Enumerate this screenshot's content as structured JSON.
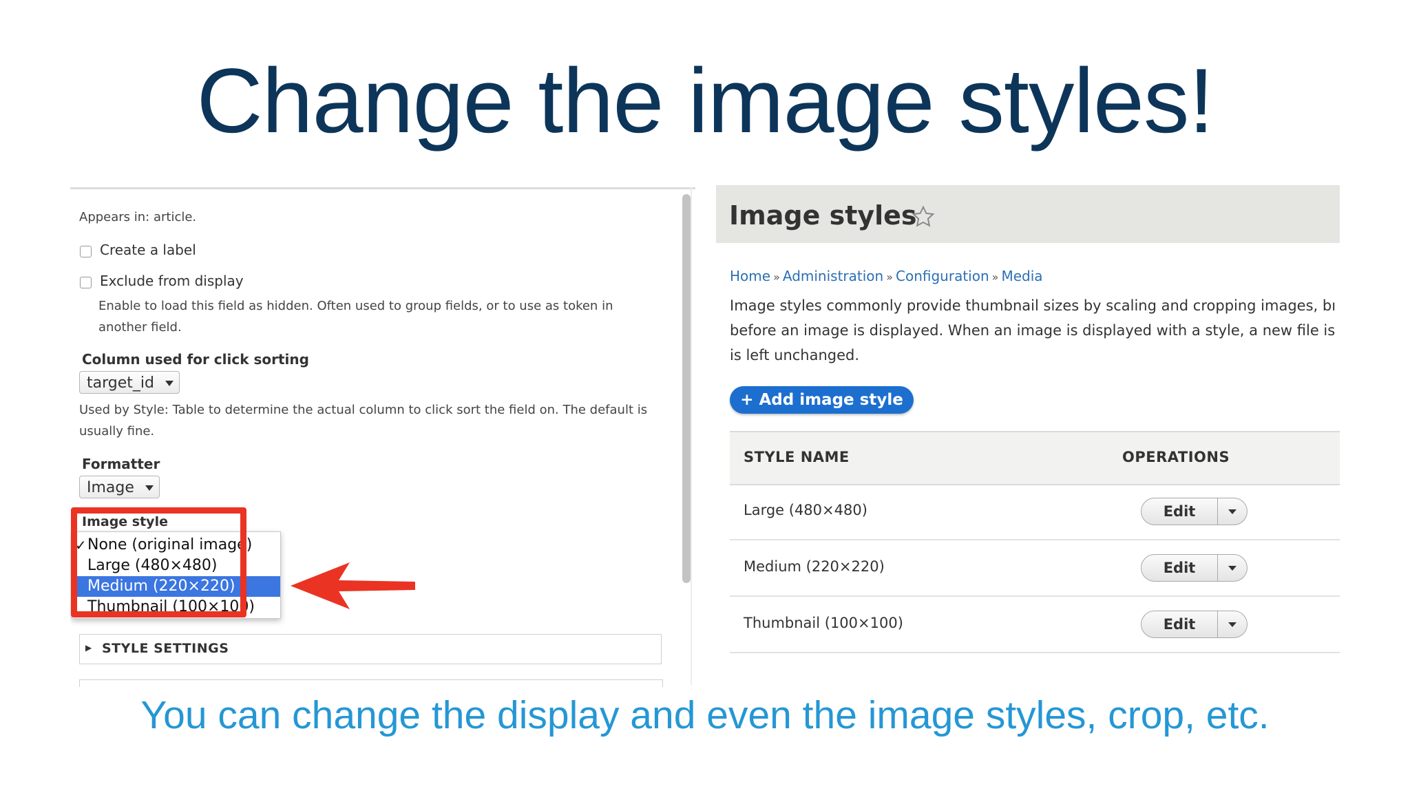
{
  "slide": {
    "title": "Change the image styles!",
    "caption": "You can change the display and even the image styles, crop, etc."
  },
  "left_panel": {
    "appears_in": "Appears in: article.",
    "create_label": "Create a label",
    "exclude_label": "Exclude from display",
    "exclude_help_line1": "Enable to load this field as hidden. Often used to group fields, or to use as token in",
    "exclude_help_line2": "another field.",
    "click_sort_heading": "Column used for click sorting",
    "click_sort_value": "target_id",
    "click_sort_help_line1": "Used by Style: Table to determine the actual column to click sort the field on. The default is",
    "click_sort_help_line2": "usually fine.",
    "formatter_heading": "Formatter",
    "formatter_value": "Image",
    "image_style_heading": "Image style",
    "image_style_options": [
      {
        "label": "None (original image)",
        "checked": true
      },
      {
        "label": "Large (480×480)"
      },
      {
        "label": "Medium (220×220)",
        "highlighted": true
      },
      {
        "label": "Thumbnail (100×100)"
      }
    ],
    "check_mark": "✓",
    "style_settings": "STYLE SETTINGS",
    "style_settings_marker": "▶",
    "highlight_color": "#ea3323",
    "selection_color": "#3b76e1"
  },
  "right_panel": {
    "title": "Image styles",
    "favorite_icon": "star-outline-icon",
    "breadcrumb": [
      "Home",
      "Administration",
      "Configuration",
      "Media"
    ],
    "breadcrumb_separator": "»",
    "description_line1": "Image styles commonly provide thumbnail sizes by scaling and cropping images, bı",
    "description_line2": "before an image is displayed. When an image is displayed with a style, a new file is",
    "description_line3": "is left unchanged.",
    "add_button": "+ Add image style",
    "columns": [
      "STYLE NAME",
      "OPERATIONS"
    ],
    "rows": [
      {
        "name": "Large (480×480)",
        "operation": "Edit"
      },
      {
        "name": "Medium (220×220)",
        "operation": "Edit"
      },
      {
        "name": "Thumbnail (100×100)",
        "operation": "Edit"
      }
    ],
    "accent_color": "#1c6fcf"
  }
}
